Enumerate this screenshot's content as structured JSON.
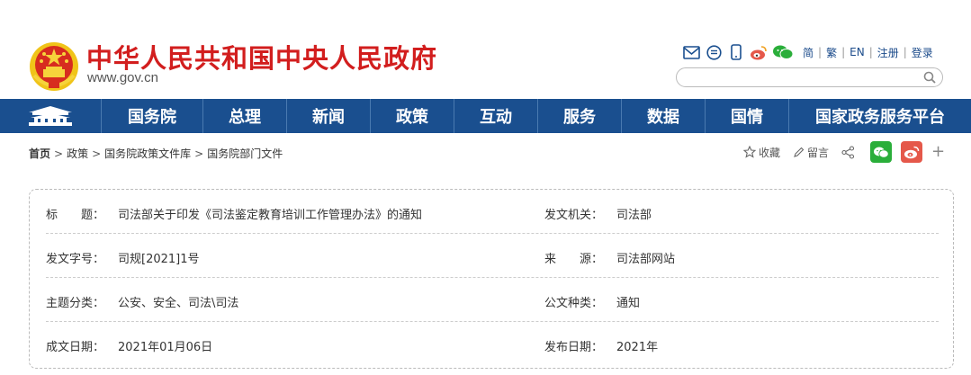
{
  "header": {
    "site_title": "中华人民共和国中央人民政府",
    "site_url": "www.gov.cn",
    "toplinks": [
      "简",
      "繁",
      "EN",
      "注册",
      "登录"
    ],
    "icons": [
      "mail-icon",
      "chat-icon",
      "mobile-icon",
      "weibo-icon",
      "wechat-icon"
    ],
    "search_placeholder": ""
  },
  "nav": {
    "items": [
      "国务院",
      "总理",
      "新闻",
      "政策",
      "互动",
      "服务",
      "数据",
      "国情",
      "国家政务服务平台"
    ]
  },
  "breadcrumb": {
    "items": [
      "首页",
      "政策",
      "国务院政策文件库",
      "国务院部门文件"
    ]
  },
  "tools": {
    "favorite": "收藏",
    "comment": "留言"
  },
  "info": {
    "rows": [
      {
        "l1": "标　　题：",
        "v1": "司法部关于印发《司法鉴定教育培训工作管理办法》的通知",
        "l2": "发文机关：",
        "v2": "司法部"
      },
      {
        "l1": "发文字号：",
        "v1": "司规[2021]1号",
        "l2": "来　　源：",
        "v2": "司法部网站"
      },
      {
        "l1": "主题分类：",
        "v1": "公安、安全、司法\\司法",
        "l2": "公文种类：",
        "v2": "通知"
      },
      {
        "l1": "成文日期：",
        "v1": "2021年01月06日",
        "l2": "发布日期：",
        "v2": "2021年"
      }
    ]
  },
  "colors": {
    "brand_red": "#d21e1e",
    "nav_blue": "#1a4f8f",
    "wechat_green": "#2aae3a",
    "weibo_red": "#e5584a"
  }
}
